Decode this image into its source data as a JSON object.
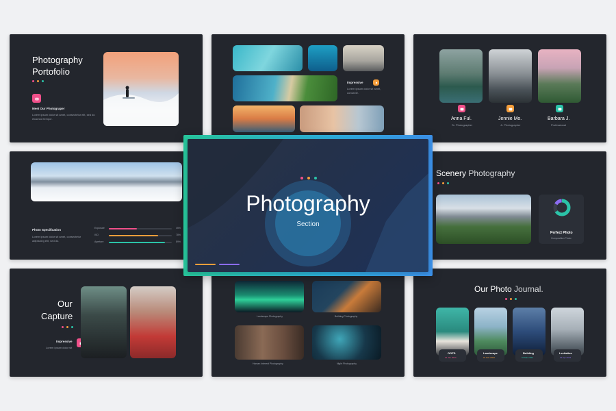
{
  "colors": {
    "bg": "#f0f1f3",
    "slide": "#23262d",
    "pink": "#f0508a",
    "orange": "#f59e3b",
    "teal": "#2bc3a8",
    "purple": "#8b6cf0",
    "accent_border": "#2ec4c9"
  },
  "slide1": {
    "title1": "Photography",
    "title2": "Portofolio",
    "label": "Meet Our Photograper",
    "desc1": "Lorem ipsum dolor sit amet, consectetur elit, sed do",
    "desc2": "eiusmod tempor."
  },
  "slide2": {
    "label": "Impressive",
    "desc1": "Lorem ipsum dolor sit amet,",
    "desc2": "consecte."
  },
  "slide3": {
    "people": [
      {
        "name": "Anna Ful.",
        "role": "Sr. Photographer"
      },
      {
        "name": "Jennie Mo.",
        "role": "Jr. Photographer"
      },
      {
        "name": "Barbara J.",
        "role": "Professional"
      }
    ]
  },
  "slide4": {
    "label": "Photo Specification",
    "desc1": "Lorem ipsum dolor sit amet, consectetur",
    "desc2": "adipiscing elit, sed do.",
    "bars": [
      {
        "label": "Exposure",
        "value": 45,
        "pct": "45%"
      },
      {
        "label": "ISO",
        "value": 78,
        "pct": "78%"
      },
      {
        "label": "Aperture",
        "value": 89,
        "pct": "89%"
      }
    ]
  },
  "center": {
    "title": "Photography",
    "subtitle": "Section"
  },
  "slide6": {
    "title1": "Scenery",
    "title2": " Photography",
    "card_title": "Perfect Photo",
    "card_sub": "Composition Photo",
    "ring_value": 65
  },
  "slide7": {
    "title1": "Our",
    "title2": "Capture",
    "label": "Impressive",
    "desc1": "Lorem ipsum dolor sit"
  },
  "slide8": {
    "captions": [
      "Landscape Photography",
      "Building Photography",
      "Human Interest Photography",
      "Night Photography"
    ]
  },
  "slide9": {
    "title1": "Our Photo",
    "title2": " Journal.",
    "items": [
      {
        "name": "OOTD",
        "date": "01 Jan 2024"
      },
      {
        "name": "Landscape",
        "date": "01 Feb 2024"
      },
      {
        "name": "Building",
        "date": "01 Mar 2024"
      },
      {
        "name": "Levitation",
        "date": "01 Apr 2024"
      }
    ]
  }
}
